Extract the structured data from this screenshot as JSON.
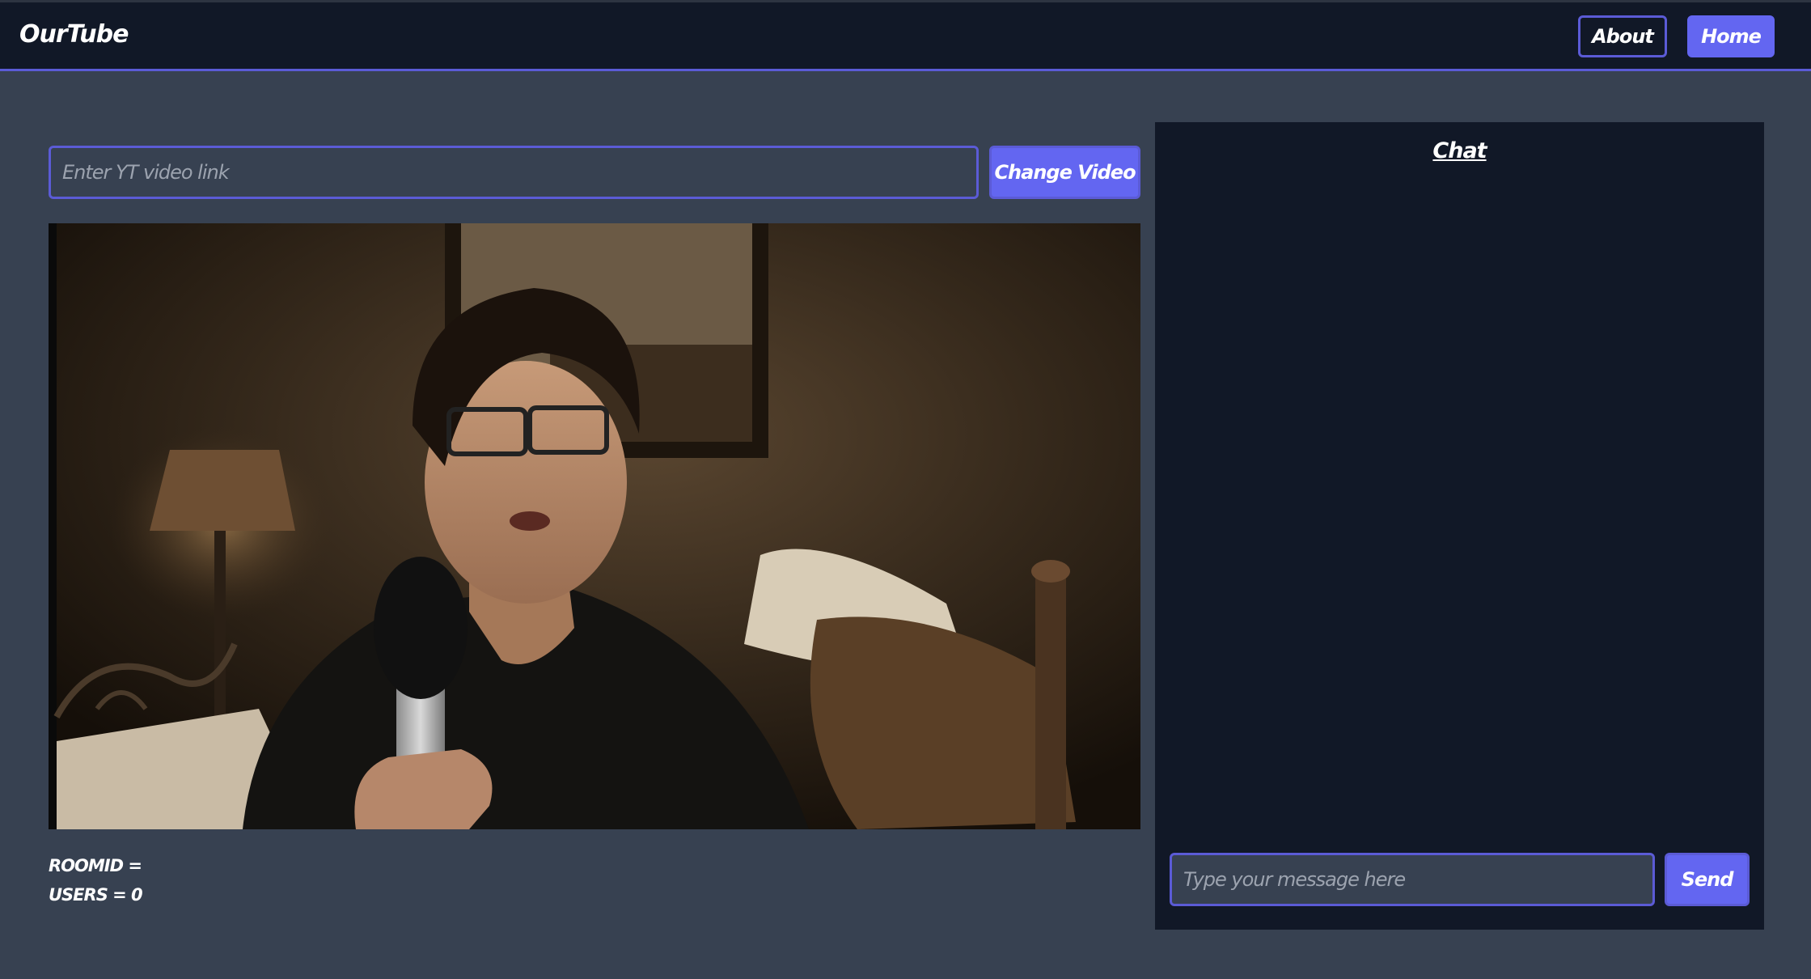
{
  "header": {
    "brand": "OurTube",
    "nav": {
      "about_label": "About",
      "home_label": "Home"
    }
  },
  "video_controls": {
    "link_placeholder": "Enter YT video link",
    "link_value": "",
    "change_label": "Change Video"
  },
  "video": {
    "content": "video-frame-person-with-microphone"
  },
  "room": {
    "roomid_text": "ROOMID =",
    "users_text": "USERS = 0"
  },
  "chat": {
    "title": "Chat",
    "message_placeholder": "Type your message here",
    "send_label": "Send"
  },
  "colors": {
    "page_bg": "#374151",
    "panel_bg": "#111827",
    "accent": "#6366f1",
    "accent_border": "#5b5bd6"
  }
}
